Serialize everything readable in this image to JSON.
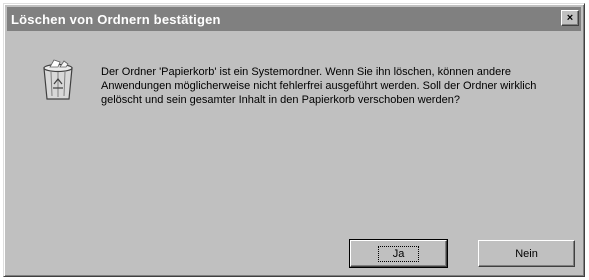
{
  "dialog": {
    "title": "Löschen von Ordnern bestätigen",
    "close_glyph": "×",
    "message": "Der Ordner 'Papierkorb' ist ein Systemordner. Wenn Sie ihn löschen, können andere Anwendungen möglicherweise nicht fehlerfrei ausgeführt werden. Soll der Ordner wirklich gelöscht und sein gesamter Inhalt in den Papierkorb verschoben werden?",
    "icon": "recycle-bin-icon",
    "buttons": {
      "yes_label": "Ja",
      "no_label": "Nein"
    }
  },
  "colors": {
    "face": "#c0c0c0",
    "titlebar_inactive": "#808080",
    "title_text": "#ffffff"
  }
}
